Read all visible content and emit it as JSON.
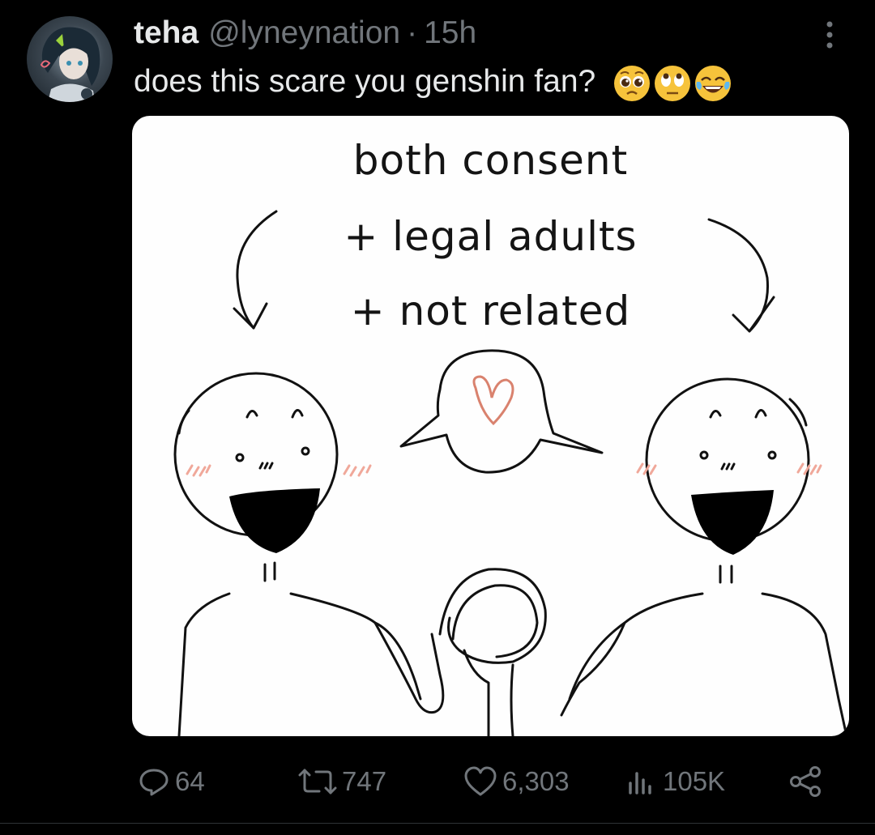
{
  "tweet": {
    "display_name": "teha",
    "handle": "@lyneynation",
    "separator": "·",
    "time_ago": "15h",
    "text": "does this scare you genshin fan?",
    "emojis": [
      "pleading-face-emoji",
      "rolling-eyes-emoji",
      "tears-of-joy-emoji"
    ]
  },
  "media": {
    "lines": [
      "both consent",
      "+ legal adults",
      "+ not related"
    ]
  },
  "actions": {
    "replies": "64",
    "retweets": "747",
    "likes": "6,303",
    "views": "105K"
  },
  "colors": {
    "background": "#000000",
    "primary_text": "#e7e9ea",
    "secondary_text": "#71767b",
    "heart_drawing": "#d9826e",
    "blush": "#f0a89a"
  }
}
